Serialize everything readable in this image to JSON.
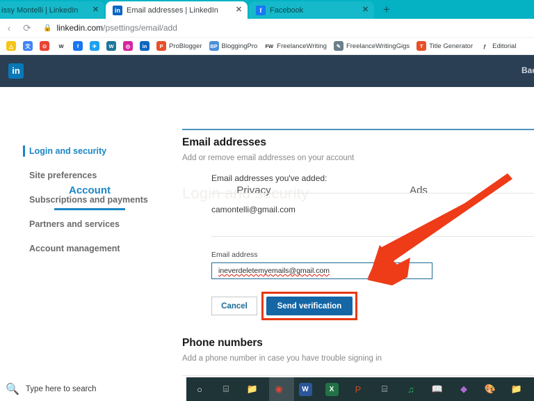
{
  "browser": {
    "tabs": [
      {
        "title": "issy Montelli | LinkedIn",
        "favicon": "linkedin-icon",
        "active": false,
        "close": "✕"
      },
      {
        "title": "Email addresses | LinkedIn",
        "favicon": "linkedin-icon",
        "active": true,
        "close": "✕"
      },
      {
        "title": "Facebook",
        "favicon": "facebook-icon",
        "active": false,
        "close": "✕"
      }
    ],
    "new_tab_label": "+",
    "reload_icon": "⟳",
    "back_icon": "‹",
    "lock_icon": "🔒",
    "url_host": "linkedin.com",
    "url_path": "/psettings/email/add",
    "tabstrip_color": "#04b2c4",
    "bookmarks": [
      {
        "label": "",
        "icon": "drive-icon",
        "color": "#f5c518",
        "glyph": "△"
      },
      {
        "label": "",
        "icon": "translate-icon",
        "color": "#4285f4",
        "glyph": "文"
      },
      {
        "label": "",
        "icon": "maps-icon",
        "color": "#ea4335",
        "glyph": "⊙"
      },
      {
        "label": "",
        "icon": "wikipedia-icon",
        "color": "#ffffff",
        "glyph": "W"
      },
      {
        "label": "",
        "icon": "facebook-icon",
        "color": "#1877f2",
        "glyph": "f"
      },
      {
        "label": "",
        "icon": "twitter-icon",
        "color": "#1da1f2",
        "glyph": "✈"
      },
      {
        "label": "",
        "icon": "wordpress-icon",
        "color": "#21759b",
        "glyph": "W"
      },
      {
        "label": "",
        "icon": "instagram-icon",
        "color": "#d6249f",
        "glyph": "◎"
      },
      {
        "label": "",
        "icon": "linkedin-icon",
        "color": "#0a66c2",
        "glyph": "in"
      },
      {
        "label": "ProBlogger",
        "icon": "problogger-icon",
        "color": "#e8502a",
        "glyph": "P"
      },
      {
        "label": "BloggingPro",
        "icon": "bloggingpro-icon",
        "color": "#4a90d9",
        "glyph": "BP"
      },
      {
        "label": "FreelanceWriting",
        "icon": "freelancewriting-icon",
        "color": "#ffffff",
        "glyph": "FW"
      },
      {
        "label": "FreelanceWritingGigs",
        "icon": "freelancewritinggigs-icon",
        "color": "#6b7f8c",
        "glyph": "✎"
      },
      {
        "label": "Title Generator",
        "icon": "titlegenerator-icon",
        "color": "#e8502a",
        "glyph": "T"
      },
      {
        "label": "Editorial ",
        "icon": "editorial-icon",
        "color": "#ffffff",
        "glyph": "ƒ"
      }
    ]
  },
  "linkedin": {
    "logo_text": "in",
    "back_label": "Bac",
    "watermark": "Login and security",
    "tabs": [
      {
        "label": "Account",
        "selected": true
      },
      {
        "label": "Privacy",
        "selected": false
      },
      {
        "label": "Ads",
        "selected": false
      }
    ],
    "sidebar": {
      "items": [
        {
          "label": "Login and security",
          "active": true
        },
        {
          "label": "Site preferences",
          "active": false
        },
        {
          "label": "Subscriptions and payments",
          "active": false
        },
        {
          "label": "Partners and services",
          "active": false
        },
        {
          "label": "Account management",
          "active": false
        }
      ]
    },
    "email_section": {
      "heading": "Email addresses",
      "subheading": "Add or remove email addresses on your account",
      "added_label": "Email addresses you've added:",
      "added_emails": [
        "camontelli@gmail.com"
      ],
      "field_label": "Email address",
      "field_value": "ineverdeletemyemails@gmail.com",
      "cancel_label": "Cancel",
      "send_label": "Send verification"
    },
    "phone_section": {
      "heading": "Phone numbers",
      "subheading": "Add a phone number in case you have trouble signing in"
    },
    "colors": {
      "accent": "#1b86c4",
      "header_bg": "#2a3f54",
      "button_blue": "#1466a5",
      "highlight_red": "#e8380d"
    }
  },
  "taskbar": {
    "search_placeholder": "Type here to search",
    "search_icon": "🔍",
    "icons": [
      {
        "name": "cortana-icon",
        "glyph": "○",
        "color": "#e8eaed",
        "square": false
      },
      {
        "name": "task-view-icon",
        "glyph": "⌸",
        "color": "#e8eaed",
        "square": false
      },
      {
        "name": "file-explorer-icon",
        "glyph": "📁",
        "color": "#f2c14b",
        "square": false
      },
      {
        "name": "chrome-icon",
        "glyph": "◉",
        "color": "#e94235",
        "square": false
      },
      {
        "name": "word-icon",
        "glyph": "W",
        "color": "#2b579a",
        "square": true
      },
      {
        "name": "excel-icon",
        "glyph": "X",
        "color": "#217346",
        "square": true
      },
      {
        "name": "powerpoint-icon",
        "glyph": "P",
        "color": "#d24726",
        "square": false
      },
      {
        "name": "calculator-icon",
        "glyph": "⌸",
        "color": "#e8eaed",
        "square": false
      },
      {
        "name": "spotify-icon",
        "glyph": "♫",
        "color": "#1db954",
        "square": false
      },
      {
        "name": "dictionary-icon",
        "glyph": "📖",
        "color": "#e8eaed",
        "square": false
      },
      {
        "name": "maps-icon",
        "glyph": "◆",
        "color": "#b06ad6",
        "square": false
      },
      {
        "name": "paint-icon",
        "glyph": "🎨",
        "color": "#e8eaed",
        "square": false
      },
      {
        "name": "folder-icon",
        "glyph": "📁",
        "color": "#f2c14b",
        "square": false
      }
    ]
  }
}
